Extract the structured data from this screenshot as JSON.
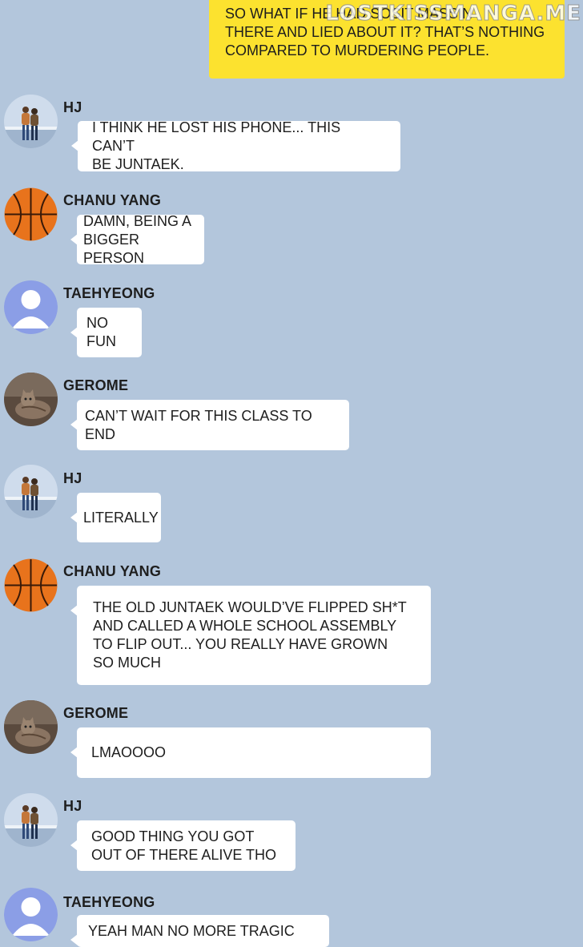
{
  "watermark": "LOSTKISSMANGA.ME",
  "own_message": "SO WHAT IF HE HAD SOSIT MASSIN\nTHERE AND LIED ABOUT IT? THAT’S NOTHING\nCOMPARED TO MURDERING PEOPLE.",
  "messages": [
    {
      "sender": "HJ",
      "avatar": "couple-photo-icon",
      "text": "I THINK HE LOST HIS PHONE... THIS CAN’T\nBE JUNTAEK."
    },
    {
      "sender": "CHANU YANG",
      "avatar": "basketball-icon",
      "text": "DAMN, BEING A\nBIGGER PERSON"
    },
    {
      "sender": "TAEHYEONG",
      "avatar": "default-user-icon",
      "text": "NO\nFUN"
    },
    {
      "sender": "GEROME",
      "avatar": "cat-photo-icon",
      "text": "CAN’T WAIT FOR THIS CLASS TO END"
    },
    {
      "sender": "HJ",
      "avatar": "couple-photo-icon",
      "text": "LITERALLY"
    },
    {
      "sender": "CHANU YANG",
      "avatar": "basketball-icon",
      "text": "THE OLD JUNTAEK WOULD’VE FLIPPED SH*T\nAND CALLED A WHOLE SCHOOL ASSEMBLY\nTO FLIP OUT... YOU REALLY HAVE GROWN\nSO MUCH"
    },
    {
      "sender": "GEROME",
      "avatar": "cat-photo-icon",
      "text": "LMAOOOO"
    },
    {
      "sender": "HJ",
      "avatar": "couple-photo-icon",
      "text": "GOOD THING YOU GOT\nOUT OF THERE ALIVE THO"
    },
    {
      "sender": "TAEHYEONG",
      "avatar": "default-user-icon",
      "text": "YEAH MAN NO MORE TRAGIC"
    }
  ],
  "colors": {
    "background": "#b3c6dc",
    "own_bubble": "#fce22f",
    "other_bubble": "#ffffff",
    "basketball": "#e8731c",
    "default_avatar": "#8b9ee6"
  }
}
